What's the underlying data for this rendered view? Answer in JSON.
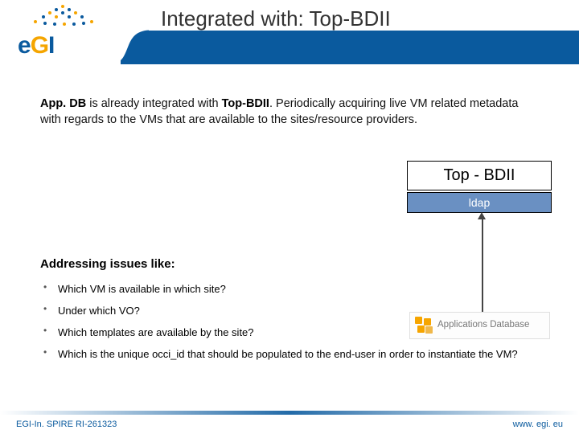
{
  "logo": {
    "text_fragments": {
      "e": "e",
      "g": "G",
      "i": "I"
    }
  },
  "title": "Integrated with: Top-BDII",
  "paragraph": {
    "appdb": "App. DB",
    "middle1": " is already integrated with ",
    "topbdii": "Top-BDII",
    "rest": ". Periodically acquiring live VM related metadata with regards to the VMs that are available to the sites/resource providers."
  },
  "box": {
    "title": "Top - BDII",
    "sub": "ldap"
  },
  "issues": {
    "heading": "Addressing issues like:",
    "items": [
      "Which VM is available in which site?",
      "Under which VO?",
      "Which templates are available by the site?",
      "Which is the unique occi_id that should be populated to the end-user in order to instantiate the VM?"
    ]
  },
  "appdb_logo_label": "Applications Database",
  "footer": {
    "left": "EGI-In. SPIRE RI-261323",
    "right": "www. egi. eu"
  }
}
